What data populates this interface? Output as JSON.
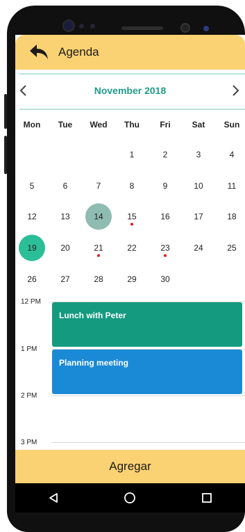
{
  "header": {
    "title": "Agenda",
    "back_icon": "back-arrow-icon"
  },
  "calendar": {
    "month_label": "November 2018",
    "prev_icon": "chevron-left-icon",
    "next_icon": "chevron-right-icon",
    "weekdays": [
      "Mon",
      "Tue",
      "Wed",
      "Thu",
      "Fri",
      "Sat",
      "Sun"
    ],
    "weeks": [
      [
        "",
        "",
        "",
        "1",
        "2",
        "3",
        "4"
      ],
      [
        "5",
        "6",
        "7",
        "8",
        "9",
        "10",
        "11"
      ],
      [
        "12",
        "13",
        "14",
        "15",
        "16",
        "17",
        "18"
      ],
      [
        "19",
        "20",
        "21",
        "22",
        "23",
        "24",
        "25"
      ],
      [
        "26",
        "27",
        "28",
        "29",
        "30",
        "",
        ""
      ]
    ],
    "selected_day": "14",
    "today": "19",
    "event_days": [
      "15",
      "21",
      "23"
    ]
  },
  "timeline": {
    "hours": [
      "12 PM",
      "1 PM",
      "2 PM",
      "3 PM"
    ],
    "events": [
      {
        "title": "Lunch with Peter",
        "color": "#149a7f"
      },
      {
        "title": "Planning meeting",
        "color": "#1b8ad6"
      }
    ]
  },
  "footer": {
    "add_label": "Agregar"
  },
  "system_nav": {
    "items": [
      "back-triangle-icon",
      "home-circle-icon",
      "recents-square-icon"
    ]
  },
  "colors": {
    "accent_yellow": "#fbd273",
    "teal": "#1f9c88",
    "selected_circle": "#8fbcb0",
    "today_circle": "#2bbf97",
    "event_dot": "#e21d1d"
  }
}
